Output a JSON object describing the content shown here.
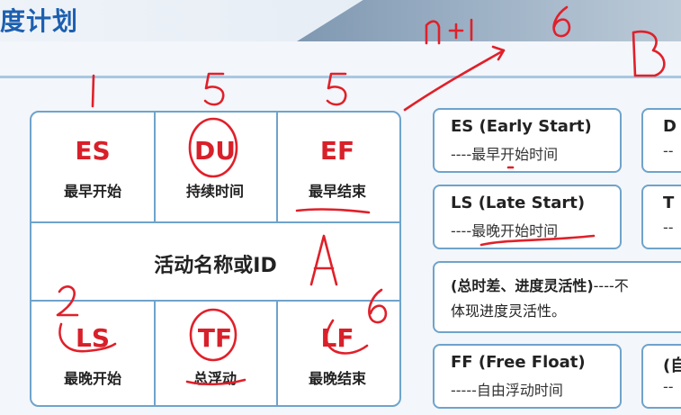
{
  "header": {
    "title": "度计划"
  },
  "grid": {
    "top": [
      {
        "abbr": "ES",
        "label": "最早开始"
      },
      {
        "abbr": "DU",
        "label": "持续时间"
      },
      {
        "abbr": "EF",
        "label": "最早结束"
      }
    ],
    "center": "活动名称或ID",
    "bottom": [
      {
        "abbr": "LS",
        "label": "最晚开始"
      },
      {
        "abbr": "TF",
        "label": "总浮动"
      },
      {
        "abbr": "LF",
        "label": "最晚结束"
      }
    ]
  },
  "cards": {
    "es": {
      "head": "ES (Early Start)",
      "sub": "----最早开始时间"
    },
    "ls": {
      "head": "LS (Late Start)",
      "sub": "----最晚开始时间"
    },
    "tf_desc": {
      "head": "(总时差、进度灵活性)",
      "tail": "----不",
      "line2": "体现进度灵活性。"
    },
    "ff": {
      "head": "FF (Free Float)",
      "sub": "-----自由浮动时间"
    },
    "right1": {
      "head": "D",
      "sub": "--"
    },
    "right2": {
      "head": "T",
      "sub": "--"
    },
    "right3": {
      "head": "(自",
      "sub": "--"
    }
  }
}
